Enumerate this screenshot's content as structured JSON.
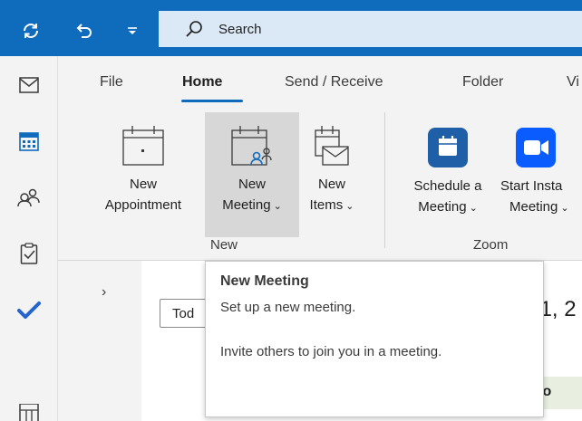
{
  "titlebar": {
    "search_label": "Search"
  },
  "ribbon": {
    "tabs": [
      {
        "label": "File"
      },
      {
        "label": "Home"
      },
      {
        "label": "Send / Receive"
      },
      {
        "label": "Folder"
      },
      {
        "label": "Vi"
      }
    ],
    "groups": {
      "new": {
        "label": "New",
        "buttons": [
          {
            "line1": "New",
            "line2": "Appointment"
          },
          {
            "line1": "New",
            "line2": "Meeting"
          },
          {
            "line1": "New",
            "line2": "Items"
          }
        ]
      },
      "zoom": {
        "label": "Zoom",
        "buttons": [
          {
            "line1": "Schedule a",
            "line2": "Meeting"
          },
          {
            "line1": "Start Insta",
            "line2": "Meeting"
          }
        ]
      }
    }
  },
  "content": {
    "today_label": "Tod",
    "date_heading": "11, 2",
    "cal_cell": "Co"
  },
  "tooltip": {
    "title": "New Meeting",
    "line1": "Set up a new meeting.",
    "line2": "Invite others to join you in a meeting."
  },
  "colors": {
    "brand": "#0f6cbd",
    "zoom_blue": "#0b5cff"
  }
}
